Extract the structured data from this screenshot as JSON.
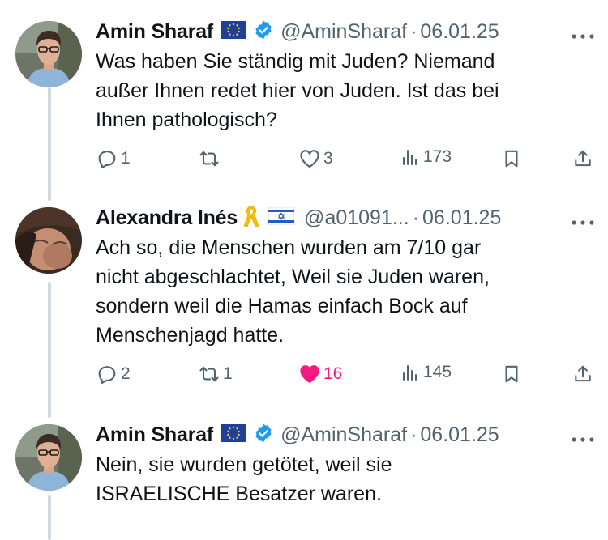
{
  "tweets": [
    {
      "author": "Amin Sharaf",
      "handle": "@AminSharaf",
      "date": "06.01.25",
      "flag": "eu-flag",
      "verified": true,
      "lines": [
        "Was haben Sie ständig mit Juden? Niemand",
        "außer Ihnen redet hier von Juden. Ist das bei",
        "Ihnen pathologisch?"
      ],
      "replies": "1",
      "retweets": "",
      "likes": "3",
      "liked": false,
      "views": "173"
    },
    {
      "author": "Alexandra Inés",
      "handle": "@a01091...",
      "date": "06.01.25",
      "flag": "israel-flag",
      "ribbon": "yellow-ribbon",
      "verified": false,
      "lines": [
        "Ach so, die Menschen wurden am 7/10 gar",
        "nicht abgeschlachtet, Weil sie Juden waren,",
        "sondern weil die Hamas einfach Bock auf",
        "Menschenjagd hatte."
      ],
      "replies": "2",
      "retweets": "1",
      "likes": "16",
      "liked": true,
      "views": "145"
    },
    {
      "author": "Amin Sharaf",
      "handle": "@AminSharaf",
      "date": "06.01.25",
      "flag": "eu-flag",
      "verified": true,
      "lines": [
        "Nein, sie wurden getötet, weil sie",
        "ISRAELISCHE Besatzer waren."
      ]
    }
  ],
  "colors": {
    "text": "#0f1419",
    "secondary": "#536471",
    "verified": "#1d9bf0",
    "like": "#f91880",
    "thread_line": "#cfd9de"
  }
}
